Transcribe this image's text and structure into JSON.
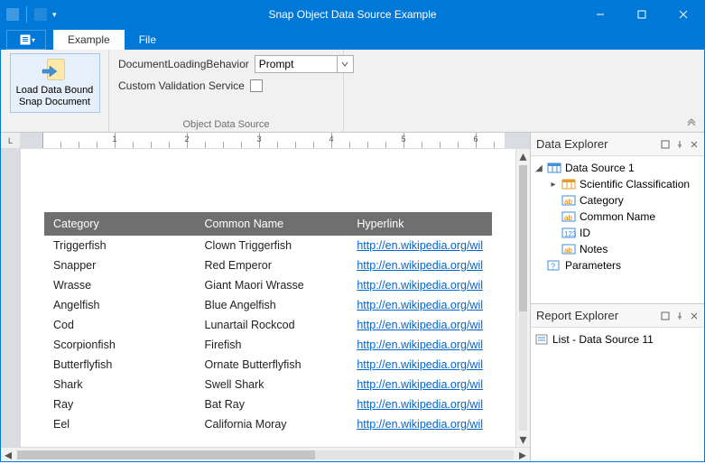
{
  "window": {
    "title": "Snap Object Data Source Example"
  },
  "tabs": {
    "file_menu": "",
    "items": [
      "Example",
      "File"
    ],
    "active_index": 0
  },
  "ribbon": {
    "group_label": "Object Data Source",
    "big_button": "Load Data Bound\nSnap Document",
    "row1_label": "DocumentLoadingBehavior",
    "row1_value": "Prompt",
    "row2_label": "Custom Validation Service",
    "row2_checked": false
  },
  "ruler": {
    "corner": "L",
    "numbers": [
      1,
      2,
      3,
      4,
      5,
      6
    ]
  },
  "table": {
    "columns": [
      "Category",
      "Common Name",
      "Hyperlink"
    ],
    "rows": [
      {
        "category": "Triggerfish",
        "common": "Clown Triggerfish",
        "link": "http://en.wikipedia.org/wil"
      },
      {
        "category": "Snapper",
        "common": "Red Emperor",
        "link": "http://en.wikipedia.org/wil"
      },
      {
        "category": "Wrasse",
        "common": "Giant Maori Wrasse",
        "link": "http://en.wikipedia.org/wil"
      },
      {
        "category": "Angelfish",
        "common": "Blue Angelfish",
        "link": "http://en.wikipedia.org/wil"
      },
      {
        "category": "Cod",
        "common": "Lunartail Rockcod",
        "link": "http://en.wikipedia.org/wil"
      },
      {
        "category": "Scorpionfish",
        "common": "Firefish",
        "link": "http://en.wikipedia.org/wil"
      },
      {
        "category": "Butterflyfish",
        "common": "Ornate Butterflyfish",
        "link": "http://en.wikipedia.org/wil"
      },
      {
        "category": "Shark",
        "common": "Swell Shark",
        "link": "http://en.wikipedia.org/wil"
      },
      {
        "category": "Ray",
        "common": "Bat Ray",
        "link": "http://en.wikipedia.org/wil"
      },
      {
        "category": "Eel",
        "common": "California Moray",
        "link": "http://en.wikipedia.org/wil"
      }
    ]
  },
  "data_explorer": {
    "title": "Data Explorer",
    "root": "Data Source 1",
    "children": [
      "Scientific Classification",
      "Category",
      "Common Name",
      "ID",
      "Notes"
    ],
    "child_types": [
      "table",
      "text",
      "text",
      "num",
      "text"
    ],
    "parameters": "Parameters"
  },
  "report_explorer": {
    "title": "Report Explorer",
    "item": "List - Data Source 11"
  }
}
